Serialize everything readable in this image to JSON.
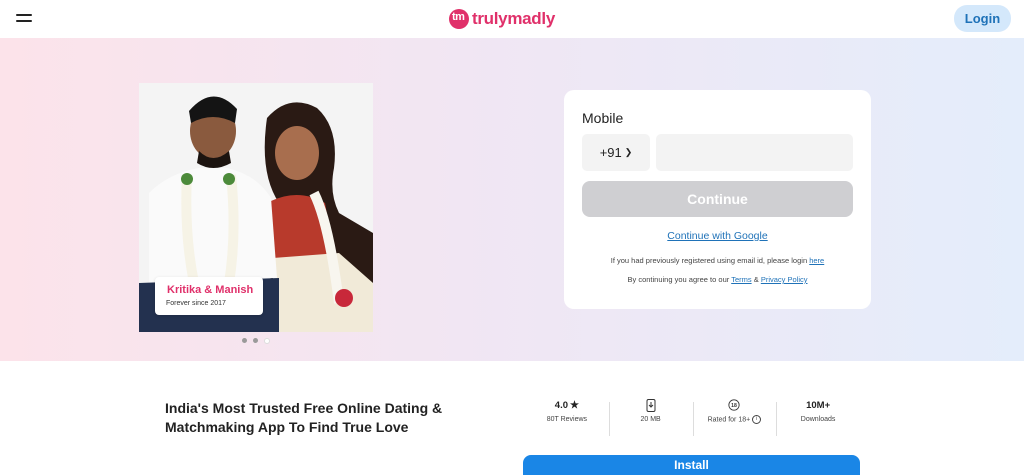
{
  "header": {
    "brand": "trulymadly",
    "login_label": "Login"
  },
  "hero": {
    "couple_name": "Kritika & Manish",
    "couple_since": "Forever since 2017",
    "carousel_dots": 3,
    "carousel_active": 3
  },
  "form": {
    "mobile_label": "Mobile",
    "country_code": "+91",
    "phone_value": "",
    "continue_label": "Continue",
    "google_label": "Continue with Google",
    "email_note": "If you had previously registered using email id, please login",
    "email_note_link": "here",
    "terms_prefix": "By continuing you agree to our",
    "terms_link": "Terms",
    "terms_amp": "&",
    "privacy_link": "Privacy Policy"
  },
  "bottom": {
    "tagline": "India's Most Trusted Free Online Dating & Matchmaking App To Find True Love",
    "stats": [
      {
        "value": "4.0",
        "icon": "star-icon",
        "label": "80T Reviews"
      },
      {
        "value": "",
        "icon": "phone-download-icon",
        "label": "20 MB"
      },
      {
        "value": "",
        "icon": "age-18-icon",
        "label": "Rated for 18+"
      },
      {
        "value": "10M+",
        "icon": "",
        "label": "Downloads"
      }
    ],
    "install_label": "Install"
  },
  "colors": {
    "brand": "#e0306a",
    "link": "#1f72b8",
    "install": "#1a86e6",
    "login_bg": "#d4e8fb",
    "continue_disabled": "#cfcfd2"
  }
}
